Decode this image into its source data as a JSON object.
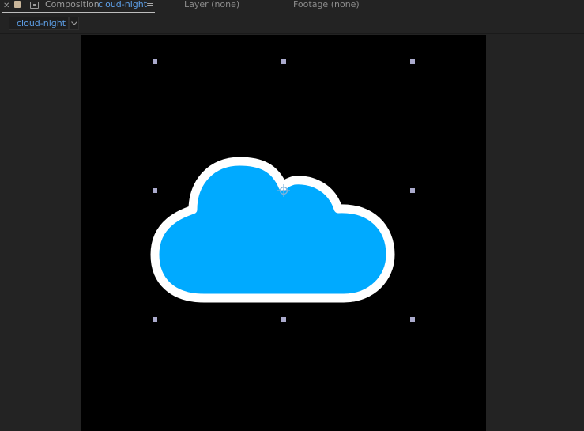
{
  "tabs": {
    "composition_label": "Composition",
    "composition_name": "cloud-night",
    "layer_label": "Layer (none)",
    "footage_label": "Footage (none)"
  },
  "composition_selector": {
    "value": "cloud-night"
  },
  "icons": {
    "close": "close-icon",
    "lock": "lock-icon",
    "composition": "composition-icon",
    "panel_menu": "hamburger-menu-icon",
    "dropdown": "chevron-down-icon",
    "anchor_point": "anchor-point-icon"
  },
  "colors": {
    "cloud_fill": "#00aaff",
    "cloud_outline": "#ffffff",
    "canvas_background": "#000000",
    "selection_handle": "#aaaacc",
    "accent_text": "#5ea0e8"
  }
}
